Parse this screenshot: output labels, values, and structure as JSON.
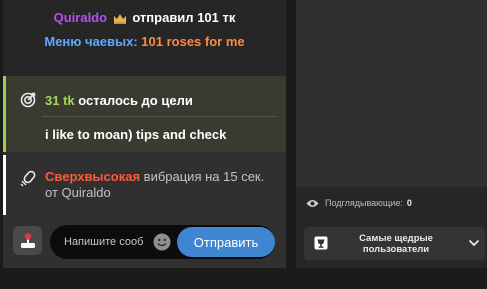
{
  "tip_message": {
    "username": "Quiraldo",
    "action": "отправил",
    "amount": "101 тк",
    "menu_label": "Меню чаевых:",
    "menu_item": "101 roses for me"
  },
  "goal": {
    "amount": "31 tk",
    "remaining_text": "осталось до цели",
    "subject": "i like to moan) tips and check"
  },
  "vibration": {
    "level": "Сверхвысокая",
    "text_mid": "вибрация на",
    "duration": "15 сек.",
    "from_label": "от",
    "username": "Quiraldo"
  },
  "composer": {
    "placeholder": "Напишите сообщение",
    "send_label": "Отправить"
  },
  "sidebar": {
    "viewers_label": "Подглядывающие:",
    "viewers_count": "0",
    "top_tippers_label": "Самые щедрые пользователи"
  },
  "colors": {
    "username": "#b94df0",
    "menu_label": "#5ea8ff",
    "menu_item": "#ff8a3d",
    "goal_amount": "#a4d655",
    "vibe_level": "#ff5a3a",
    "send_button": "#3e86d1"
  },
  "icons": {
    "crown": "crown-icon",
    "goal": "target-icon",
    "vibe": "vibration-icon",
    "game": "joystick-icon",
    "emoji": "emoji-icon",
    "eye": "eye-icon",
    "tippers": "trophy-icon",
    "chevron": "chevron-down-icon"
  }
}
